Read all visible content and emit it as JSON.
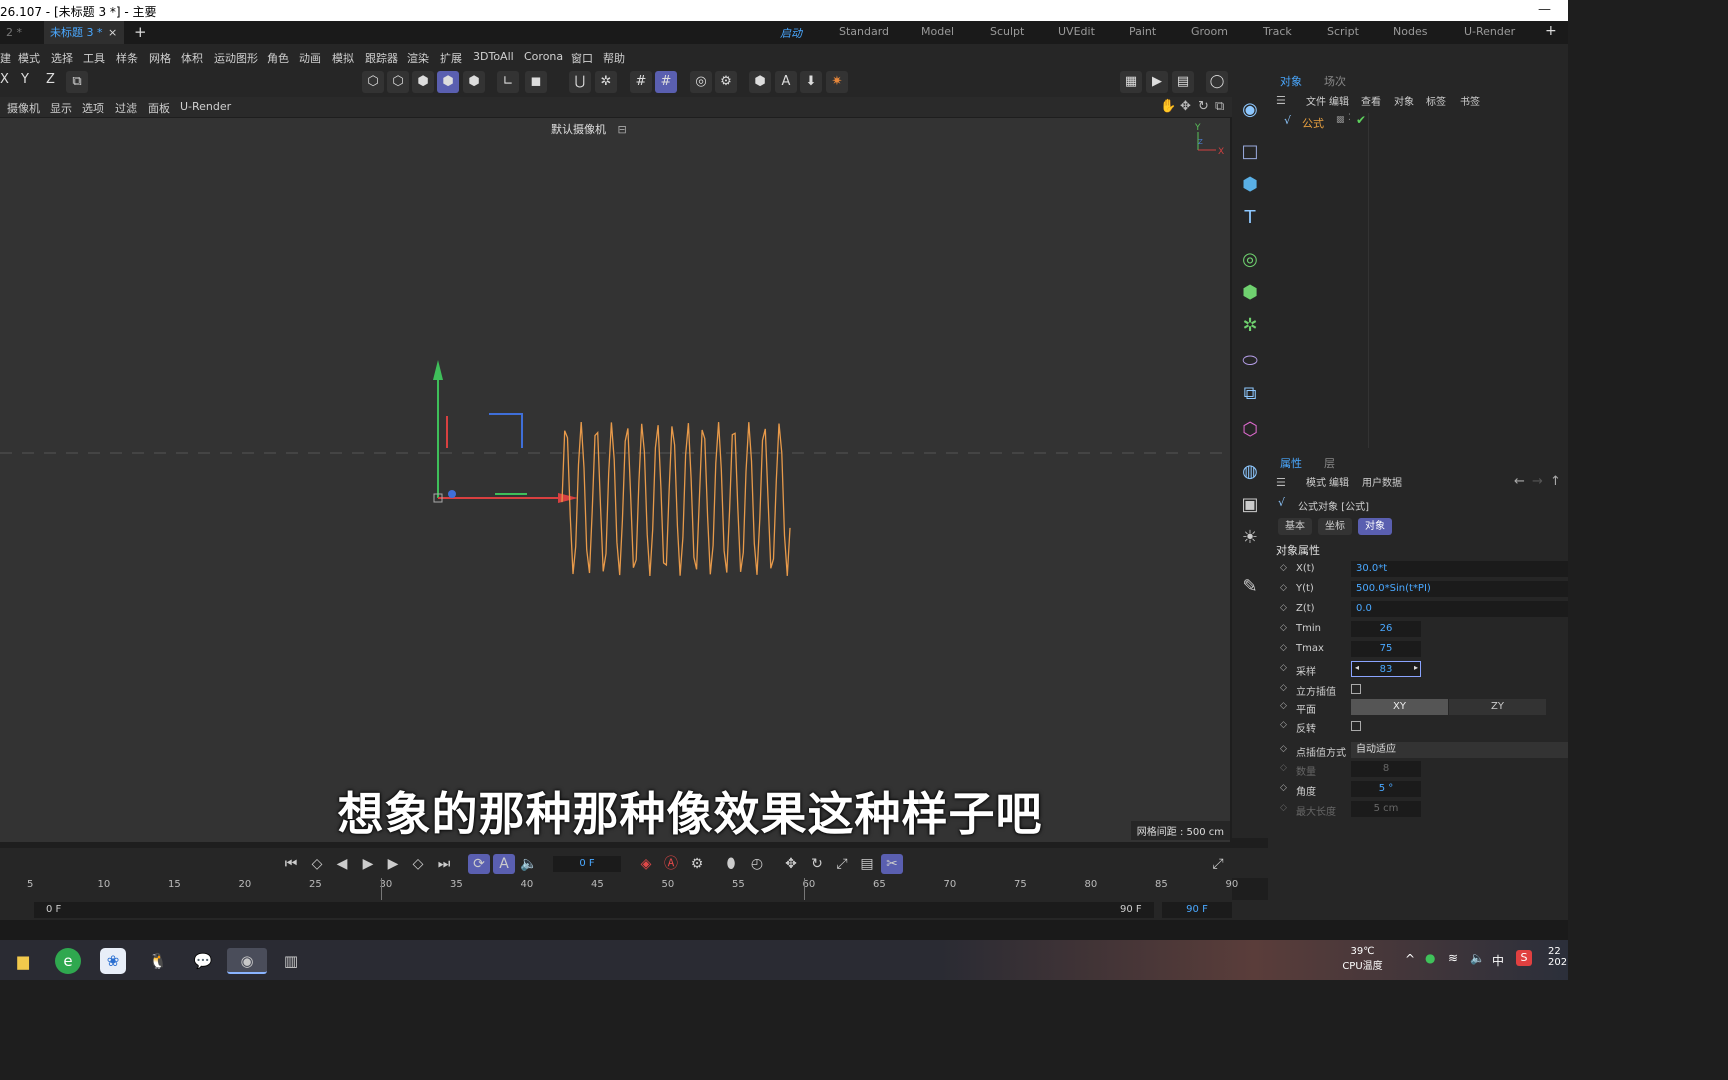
{
  "window": {
    "title": "26.107 - [未标题 3 *] - 主要",
    "minimize": "—"
  },
  "tabs": {
    "doc_prev": "2 *",
    "doc_active": "未标题 3 *",
    "close": "×",
    "add": "+"
  },
  "layouts": [
    "启动",
    "Standard",
    "Model",
    "Sculpt",
    "UVEdit",
    "Paint",
    "Groom",
    "Track",
    "Script",
    "Nodes",
    "U-Render"
  ],
  "layout_add": "+",
  "menus": [
    "建",
    "模式",
    "选择",
    "工具",
    "样条",
    "网格",
    "体积",
    "运动图形",
    "角色",
    "动画",
    "模拟",
    "跟踪器",
    "渲染",
    "扩展",
    "3DToAll",
    "Corona",
    "窗口",
    "帮助"
  ],
  "toolbar": {
    "axis_x": "X",
    "axis_y": "Y",
    "axis_z": "Z"
  },
  "viewport_menu": [
    "摄像机",
    "显示",
    "选项",
    "过滤",
    "面板",
    "U-Render"
  ],
  "viewport": {
    "camera_label": "默认摄像机",
    "grid_spacing": "网格间距 : 500 cm",
    "subtitle": "想象的那种那种像效果这种样子吧",
    "axis_y": "Y",
    "axis_x": "X",
    "axis_z": "Z",
    "curve_color": "#e89a4a"
  },
  "timeline": {
    "current_frame": "0 F",
    "ruler_ticks": [
      "5",
      "10",
      "15",
      "20",
      "25",
      "30",
      "35",
      "40",
      "45",
      "50",
      "55",
      "60",
      "65",
      "70",
      "75",
      "80",
      "85",
      "90"
    ],
    "range_start": "0 F",
    "range_end": "90 F",
    "range_end_field": "90 F"
  },
  "object_panel": {
    "tabs": [
      "对象",
      "场次"
    ],
    "menu": [
      "文件",
      "编辑",
      "查看",
      "对象",
      "标签",
      "书签"
    ],
    "object_name": "公式"
  },
  "attr_panel": {
    "tabs": [
      "属性",
      "层"
    ],
    "menu": [
      "模式",
      "编辑",
      "用户数据"
    ],
    "object_title": "公式对象 [公式]",
    "subtabs": [
      "基本",
      "坐标",
      "对象"
    ],
    "section": "对象属性",
    "rows": [
      {
        "label": "X(t)",
        "value": "30.0*t"
      },
      {
        "label": "Y(t)",
        "value": "500.0*Sin(t*PI)"
      },
      {
        "label": "Z(t)",
        "value": "0.0"
      },
      {
        "label": "Tmin",
        "value": "26"
      },
      {
        "label": "Tmax",
        "value": "75"
      },
      {
        "label": "采样",
        "value": "83"
      }
    ],
    "cubic_label": "立方插值",
    "plane_label": "平面",
    "plane_options": [
      "XY",
      "ZY"
    ],
    "reverse_label": "反转",
    "interp_label": "点插值方式",
    "interp_value": "自动适应",
    "count_label": "数量",
    "count_value": "8",
    "angle_label": "角度",
    "angle_value": "5 °",
    "maxlen_label": "最大长度",
    "maxlen_value": "5 cm"
  },
  "taskbar": {
    "temp": "39℃",
    "temp_label": "CPU温度",
    "ime": "中",
    "clock_top": "22",
    "clock_bottom": "202"
  }
}
